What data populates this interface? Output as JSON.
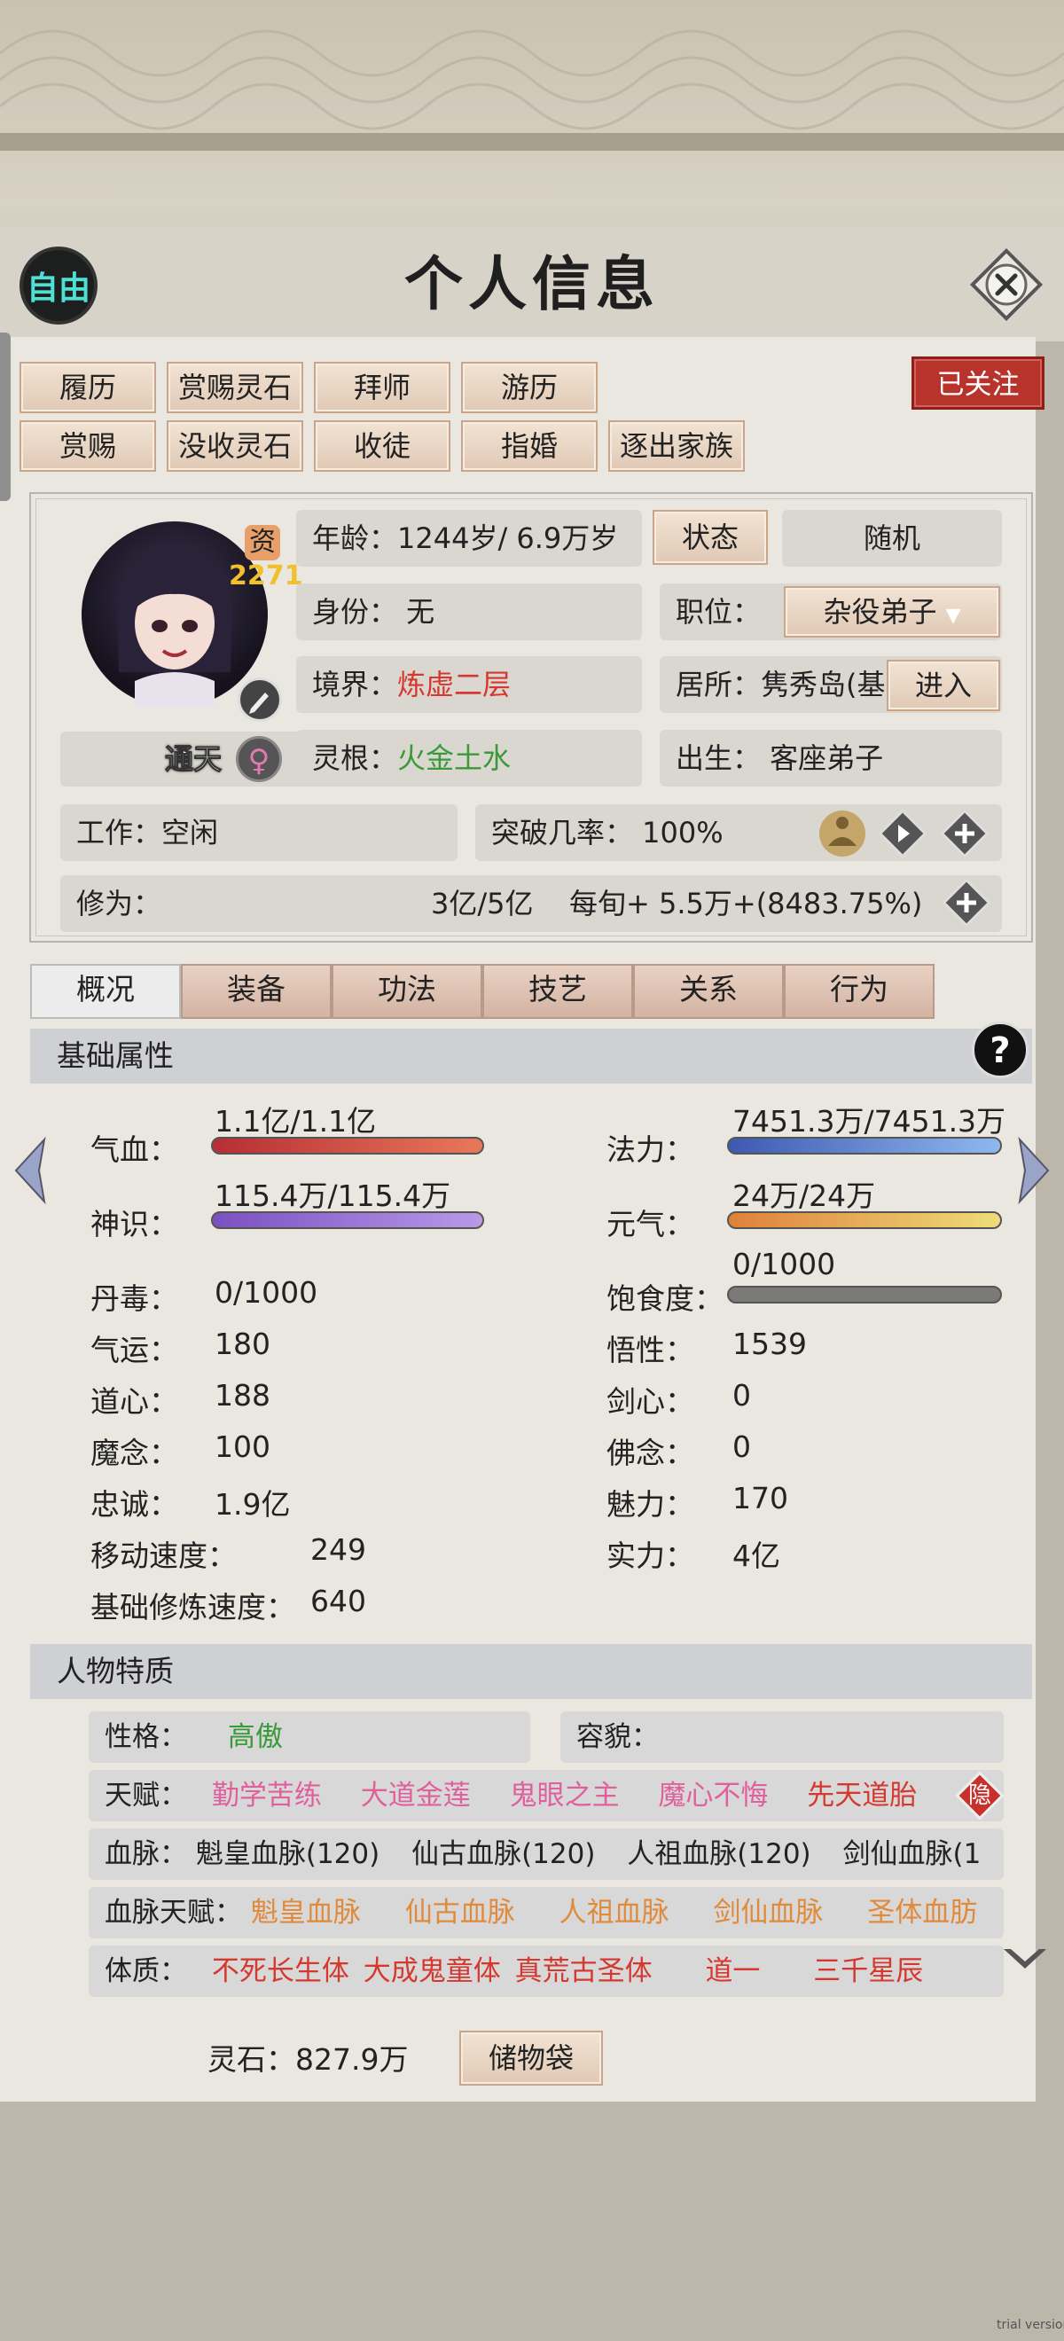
{
  "header": {
    "title": "个人信息",
    "free_label": "自由",
    "followed_label": "已关注"
  },
  "actions_row1": [
    "履历",
    "赏赐灵石",
    "拜师",
    "游历"
  ],
  "actions_row2": [
    "赏赐",
    "没收灵石",
    "收徒",
    "指婚",
    "逐出家族"
  ],
  "profile": {
    "aptitude_label": "资",
    "aptitude_value": "2271",
    "title_badge": "通天",
    "age": "年龄：1244岁/ 6.9万岁",
    "status_button": "状态",
    "random_button": "随机",
    "identity": "身份：  无",
    "position_label": "职位：",
    "position_value": "杂役弟子",
    "realm_label": "境界：",
    "realm_value": "炼虚二层",
    "residence": "居所：隽秀岛(基",
    "enter_button": "进入",
    "root_label": "灵根：",
    "root_value": "火金土水",
    "birth": "出生：  客座弟子",
    "work": "工作：空闲",
    "breakthrough": "突破几率：  100%",
    "practice_label": "修为：",
    "practice_value": "3亿/5亿",
    "practice_rate": "每旬+   5.5万+(8483.75%)"
  },
  "tabs": [
    "概况",
    "装备",
    "功法",
    "技艺",
    "关系",
    "行为"
  ],
  "basic": {
    "heading": "基础属性",
    "qixue_label": "气血：",
    "qixue_value": "1.1亿/1.1亿",
    "qixue_fill": 1.0,
    "fali_label": "法力：",
    "fali_value": "7451.3万/7451.3万",
    "fali_fill": 1.0,
    "shenshi_label": "神识：",
    "shenshi_value": "115.4万/115.4万",
    "shenshi_fill": 1.0,
    "yuanqi_label": "元气：",
    "yuanqi_value": "24万/24万",
    "yuanqi_fill": 1.0,
    "satiety_label": "饱食度：",
    "satiety_value": "0/1000",
    "satiety_fill": 0.0,
    "left_stats": [
      {
        "label": "丹毒：",
        "value": "0/1000"
      },
      {
        "label": "气运：",
        "value": "180"
      },
      {
        "label": "道心：",
        "value": "188"
      },
      {
        "label": "魔念：",
        "value": "100"
      },
      {
        "label": "忠诚：",
        "value": "1.9亿"
      },
      {
        "label": "移动速度：",
        "value": "249"
      },
      {
        "label": "基础修炼速度：",
        "value": "640"
      }
    ],
    "right_stats": [
      {
        "label": "悟性：",
        "value": "1539"
      },
      {
        "label": "剑心：",
        "value": "0"
      },
      {
        "label": "佛念：",
        "value": "0"
      },
      {
        "label": "魅力：",
        "value": "170"
      },
      {
        "label": "实力：",
        "value": "4亿"
      }
    ]
  },
  "traits": {
    "heading": "人物特质",
    "personality_label": "性格：",
    "personality_value": "高傲",
    "appearance_label": "容貌：",
    "talent_label": "天赋：",
    "talents": [
      "勤学苦练",
      "大道金莲",
      "鬼眼之主",
      "魔心不悔",
      "先天道胎"
    ],
    "hide_label": "隐",
    "bloodline_label": "血脉：",
    "bloodlines": [
      "魁皇血脉(120)",
      "仙古血脉(120)",
      "人祖血脉(120)",
      "剑仙血脉(1"
    ],
    "bloodline_talent_label": "血脉天赋：",
    "bloodline_talents": [
      "魁皇血脉",
      "仙古血脉",
      "人祖血脉",
      "剑仙血脉",
      "圣体血肪"
    ],
    "physique_label": "体质：",
    "physiques": [
      "不死长生体",
      "大成鬼童体",
      "真荒古圣体",
      "道一",
      "三千星辰"
    ]
  },
  "footer": {
    "spirit_stone": "灵石：827.9万",
    "bag_button": "储物袋"
  },
  "watermark": "trial version",
  "colors": {
    "follow_red": "#b8332c",
    "realm_red": "#d6382f",
    "root_green": "#3a9a3a",
    "talent_pink": "#e0609e",
    "bloodline_orange": "#e08a3c",
    "hp_bar": "#c0393a",
    "mana_bar": "#5b7fd8",
    "spirit_bar": "#8e6ad0",
    "yuanqi_bar": "#e6a24a"
  }
}
